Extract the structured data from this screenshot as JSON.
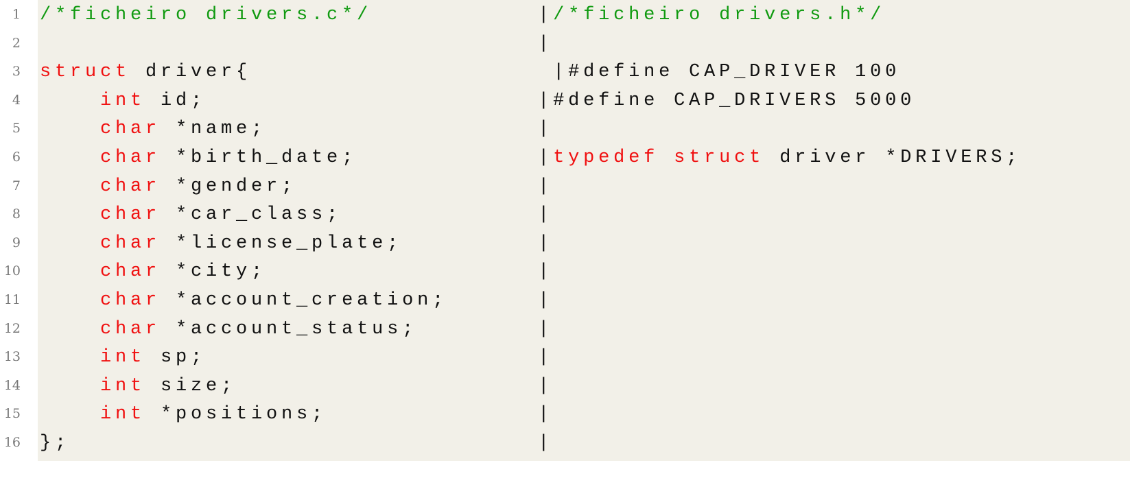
{
  "colors": {
    "background": "#f2f0e8",
    "comment": "#109a10",
    "keyword": "#f01010",
    "plain": "#111111",
    "line_number": "#777777"
  },
  "lines": [
    {
      "n": "1",
      "segs": [
        {
          "t": "/*ficheiro drivers.c*/",
          "k": "comment"
        },
        {
          "t": "           |",
          "k": "plain"
        },
        {
          "t": "/*ficheiro drivers.h*/",
          "k": "comment"
        }
      ]
    },
    {
      "n": "2",
      "segs": [
        {
          "t": "                                 |",
          "k": "plain"
        }
      ]
    },
    {
      "n": "3",
      "segs": [
        {
          "t": "struct",
          "k": "keyword"
        },
        {
          "t": " driver{                    |#define CAP_DRIVER 100",
          "k": "plain"
        }
      ]
    },
    {
      "n": "4",
      "segs": [
        {
          "t": "    ",
          "k": "plain"
        },
        {
          "t": "int",
          "k": "keyword"
        },
        {
          "t": " id;                      |#define CAP_DRIVERS 5000",
          "k": "plain"
        }
      ]
    },
    {
      "n": "5",
      "segs": [
        {
          "t": "    ",
          "k": "plain"
        },
        {
          "t": "char",
          "k": "keyword"
        },
        {
          "t": " *name;                  |",
          "k": "plain"
        }
      ]
    },
    {
      "n": "6",
      "segs": [
        {
          "t": "    ",
          "k": "plain"
        },
        {
          "t": "char",
          "k": "keyword"
        },
        {
          "t": " *birth_date;            |",
          "k": "plain"
        },
        {
          "t": "typedef",
          "k": "keyword"
        },
        {
          "t": " ",
          "k": "plain"
        },
        {
          "t": "struct",
          "k": "keyword"
        },
        {
          "t": " driver *DRIVERS;",
          "k": "plain"
        }
      ]
    },
    {
      "n": "7",
      "segs": [
        {
          "t": "    ",
          "k": "plain"
        },
        {
          "t": "char",
          "k": "keyword"
        },
        {
          "t": " *gender;                |",
          "k": "plain"
        }
      ]
    },
    {
      "n": "8",
      "segs": [
        {
          "t": "    ",
          "k": "plain"
        },
        {
          "t": "char",
          "k": "keyword"
        },
        {
          "t": " *car_class;             |",
          "k": "plain"
        }
      ]
    },
    {
      "n": "9",
      "segs": [
        {
          "t": "    ",
          "k": "plain"
        },
        {
          "t": "char",
          "k": "keyword"
        },
        {
          "t": " *license_plate;         |",
          "k": "plain"
        }
      ]
    },
    {
      "n": "10",
      "segs": [
        {
          "t": "    ",
          "k": "plain"
        },
        {
          "t": "char",
          "k": "keyword"
        },
        {
          "t": " *city;                  |",
          "k": "plain"
        }
      ]
    },
    {
      "n": "11",
      "segs": [
        {
          "t": "    ",
          "k": "plain"
        },
        {
          "t": "char",
          "k": "keyword"
        },
        {
          "t": " *account_creation;      |",
          "k": "plain"
        }
      ]
    },
    {
      "n": "12",
      "segs": [
        {
          "t": "    ",
          "k": "plain"
        },
        {
          "t": "char",
          "k": "keyword"
        },
        {
          "t": " *account_status;        |",
          "k": "plain"
        }
      ]
    },
    {
      "n": "13",
      "segs": [
        {
          "t": "    ",
          "k": "plain"
        },
        {
          "t": "int",
          "k": "keyword"
        },
        {
          "t": " sp;                      |",
          "k": "plain"
        }
      ]
    },
    {
      "n": "14",
      "segs": [
        {
          "t": "    ",
          "k": "plain"
        },
        {
          "t": "int",
          "k": "keyword"
        },
        {
          "t": " size;                    |",
          "k": "plain"
        }
      ]
    },
    {
      "n": "15",
      "segs": [
        {
          "t": "    ",
          "k": "plain"
        },
        {
          "t": "int",
          "k": "keyword"
        },
        {
          "t": " *positions;              |",
          "k": "plain"
        }
      ]
    },
    {
      "n": "16",
      "segs": [
        {
          "t": "};                               |",
          "k": "plain"
        }
      ]
    }
  ]
}
